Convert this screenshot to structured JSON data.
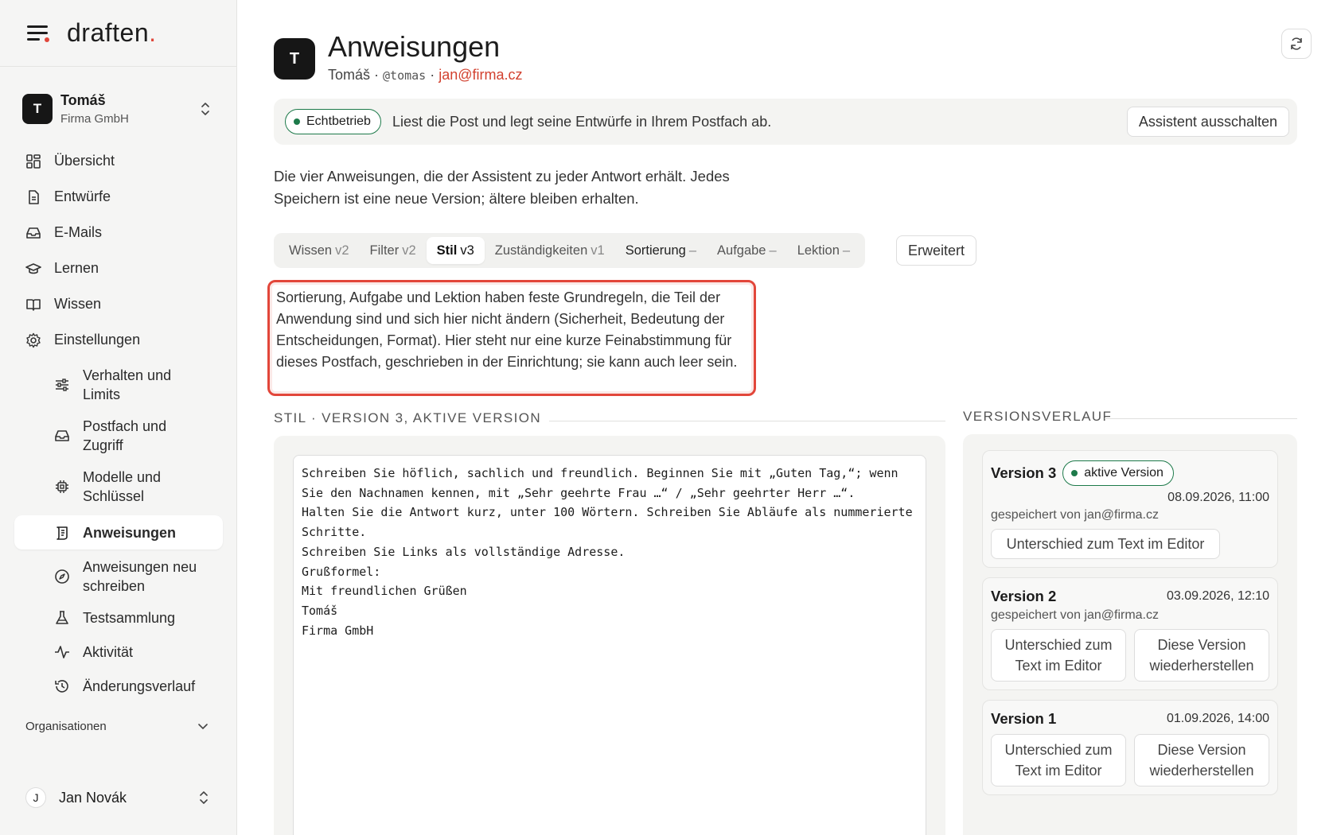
{
  "brand": {
    "name": "draften",
    "dot": "."
  },
  "account": {
    "initial": "T",
    "name": "Tomáš",
    "org": "Firma GmbH"
  },
  "nav": {
    "items": [
      {
        "label": "Übersicht"
      },
      {
        "label": "Entwürfe"
      },
      {
        "label": "E-Mails"
      },
      {
        "label": "Lernen"
      },
      {
        "label": "Wissen"
      },
      {
        "label": "Einstellungen"
      }
    ],
    "sub": [
      {
        "label": "Verhalten und Limits"
      },
      {
        "label": "Postfach und Zugriff"
      },
      {
        "label": "Modelle und Schlüssel"
      },
      {
        "label": "Anweisungen"
      },
      {
        "label": "Anweisungen neu schreiben"
      },
      {
        "label": "Testsammlung"
      },
      {
        "label": "Aktivität"
      },
      {
        "label": "Änderungsverlauf"
      }
    ],
    "organisations": "Organisationen"
  },
  "user": {
    "initial": "J",
    "name": "Jan Novák"
  },
  "header": {
    "initial": "T",
    "title": "Anweisungen",
    "name": "Tomáš",
    "sep": " · ",
    "handle": "@tomas",
    "email": "jan@firma.cz"
  },
  "status": {
    "badge": "Echtbetrieb",
    "text": "Liest die Post und legt seine Entwürfe in Ihrem Postfach ab.",
    "off_button": "Assistent ausschalten"
  },
  "intro": "Die vier Anweisungen, die der Assistent zu jeder Antwort erhält. Jedes Speichern ist eine neue Version; ältere bleiben erhalten.",
  "tabs": [
    {
      "label": "Wissen",
      "ver": "v2"
    },
    {
      "label": "Filter",
      "ver": "v2"
    },
    {
      "label": "Stil",
      "ver": "v3"
    },
    {
      "label": "Zuständigkeiten",
      "ver": "v1"
    },
    {
      "label": "Sortierung",
      "ver": "–"
    },
    {
      "label": "Aufgabe",
      "ver": "–"
    },
    {
      "label": "Lektion",
      "ver": "–"
    }
  ],
  "advanced": "Erweitert",
  "note": "Sortierung, Aufgabe und Lektion haben feste Grundregeln, die Teil der Anwendung sind und sich hier nicht ändern (Sicherheit, Bedeutung der Entscheidungen, Format). Hier steht nur eine kurze Feinabstimmung für dieses Postfach, geschrieben in der Einrichtung; sie kann auch leer sein.",
  "editor": {
    "label": "STIL · VERSION 3, AKTIVE VERSION",
    "text": "Schreiben Sie höflich, sachlich und freundlich. Beginnen Sie mit „Guten Tag,“; wenn\nSie den Nachnamen kennen, mit „Sehr geehrte Frau …“ / „Sehr geehrter Herr …“.\nHalten Sie die Antwort kurz, unter 100 Wörtern. Schreiben Sie Abläufe als nummerierte\nSchritte.\nSchreiben Sie Links als vollständige Adresse.\nGrußformel:\nMit freundlichen Grüßen\nTomáš\nFirma GmbH"
  },
  "history": {
    "label": "VERSIONSVERLAUF",
    "versions": [
      {
        "name": "Version 3",
        "active_badge": "aktive Version",
        "date": "08.09.2026, 11:00",
        "saved": "gespeichert von jan@firma.cz",
        "diff": "Unterschied zum Text im Editor"
      },
      {
        "name": "Version 2",
        "date": "03.09.2026, 12:10",
        "saved": "gespeichert von jan@firma.cz",
        "diff": "Unterschied zum Text im Editor",
        "restore": "Diese Version wiederherstellen"
      },
      {
        "name": "Version 1",
        "date": "01.09.2026, 14:00",
        "diff": "Unterschied zum Text im Editor",
        "restore": "Diese Version wiederherstellen"
      }
    ]
  },
  "colors": {
    "accent": "#e0463a",
    "email": "#d2412f",
    "live": "#1d7a4a"
  }
}
